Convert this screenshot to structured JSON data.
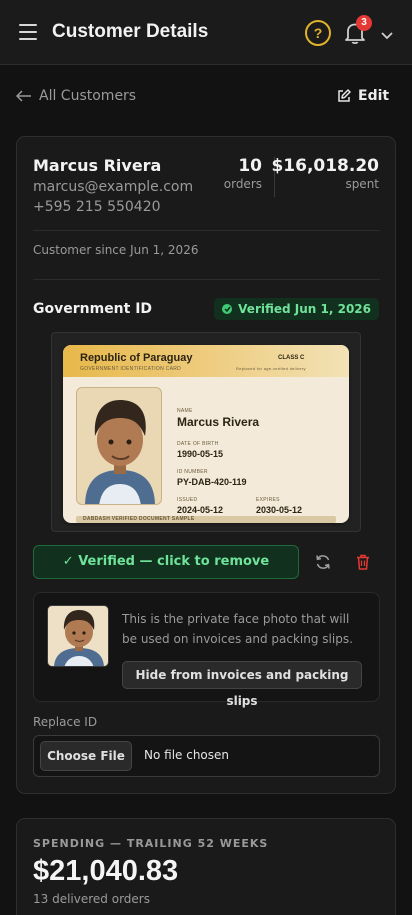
{
  "header": {
    "title": "Customer Details",
    "help_glyph": "?",
    "notifications_count": "3"
  },
  "nav": {
    "back_label": "All Customers",
    "edit_label": "Edit"
  },
  "customer": {
    "name": "Marcus Rivera",
    "email": "marcus@example.com",
    "phone": "+595 215 550420",
    "orders_value": "10",
    "orders_label": "orders",
    "spent_value": "$16,018.20",
    "spent_label": "spent",
    "since": "Customer since Jun 1, 2026"
  },
  "gov_id": {
    "heading": "Government ID",
    "status": "Verified Jun 1, 2026",
    "card": {
      "country": "Republic of Paraguay",
      "subtitle": "GOVERNMENT IDENTIFICATION CARD",
      "class": "CLASS C",
      "class_note": "Replaced for age-verified delivery",
      "name_label": "NAME",
      "name": "Marcus Rivera",
      "dob_label": "DATE OF BIRTH",
      "dob": "1990-05-15",
      "idnum_label": "ID NUMBER",
      "idnum": "PY-DAB-420-119",
      "issued_label": "ISSUED",
      "issued": "2024-05-12",
      "expires_label": "EXPIRES",
      "expires": "2030-05-12",
      "footer": "DABDASH VERIFIED DOCUMENT SAMPLE"
    },
    "verified_button": "✓ Verified — click to remove",
    "face_note": "This is the private face photo that will be used on invoices and packing slips.",
    "hide_button": "Hide from invoices and packing slips",
    "replace_label": "Replace ID",
    "choose_file": "Choose File",
    "no_file": "No file chosen"
  },
  "spending": {
    "heading": "SPENDING — TRAILING 52 WEEKS",
    "amount": "$21,040.83",
    "orders_note": "13 delivered orders"
  },
  "colors": {
    "accent_yellow": "#e0b32a",
    "verified_green": "#6fe39a",
    "danger_red": "#e53935"
  }
}
